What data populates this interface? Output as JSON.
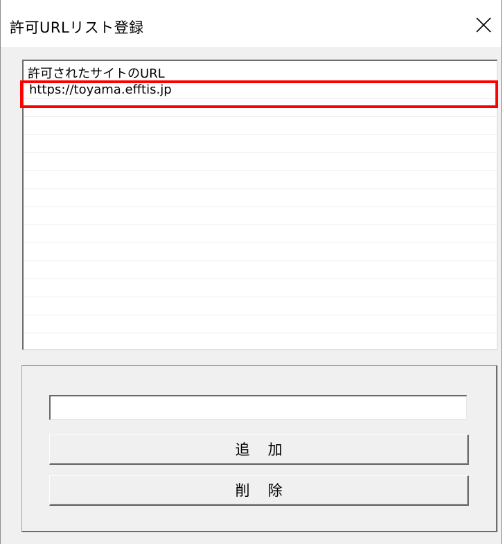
{
  "window": {
    "title": "許可URLリスト登録",
    "close_label": "×"
  },
  "listview": {
    "column_header": "許可されたサイトのURL",
    "rows": [
      "https://toyama.efftis.jp",
      "",
      "",
      "",
      "",
      "",
      "",
      "",
      "",
      "",
      "",
      "",
      "",
      "",
      ""
    ]
  },
  "form": {
    "url_input_value": "",
    "add_button_label": "追加",
    "delete_button_label": "削除"
  },
  "colors": {
    "highlight": "#ff0000",
    "window_bg": "#f0f0f0"
  }
}
